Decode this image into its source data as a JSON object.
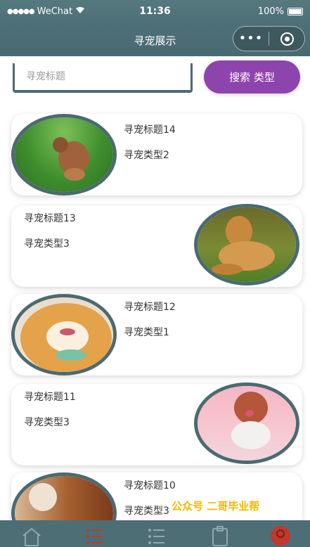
{
  "status": {
    "carrier": "WeChat",
    "time": "11:36",
    "battery": "100%"
  },
  "nav": {
    "title": "寻宠展示",
    "more": "•••"
  },
  "search": {
    "placeholder": "寻宠标题",
    "button_label": "搜索  类型"
  },
  "cards": [
    {
      "title": "寻宠标题14",
      "type": "寻宠类型2",
      "image": "brown poodle puppy on grass"
    },
    {
      "title": "寻宠标题13",
      "type": "寻宠类型3",
      "image": "golden retriever lying on grass"
    },
    {
      "title": "寻宠标题12",
      "type": "寻宠类型1",
      "image": "smiling shiba inu with scarf"
    },
    {
      "title": "寻宠标题11",
      "type": "寻宠类型3",
      "image": "poodle in pink shirt"
    },
    {
      "title": "寻宠标题10",
      "type": "寻宠类型3",
      "image": "dog close up"
    }
  ],
  "watermark": "公众号 二哥毕业帮",
  "colors": {
    "theme": "#4e6e76",
    "button": "#8e44ad",
    "watermark": "#f5b800",
    "active_tab": "#c0392b"
  },
  "tabs": [
    {
      "icon": "home-icon"
    },
    {
      "icon": "list-icon"
    },
    {
      "icon": "list-icon"
    },
    {
      "icon": "clipboard-icon"
    },
    {
      "icon": "profile-icon"
    }
  ]
}
